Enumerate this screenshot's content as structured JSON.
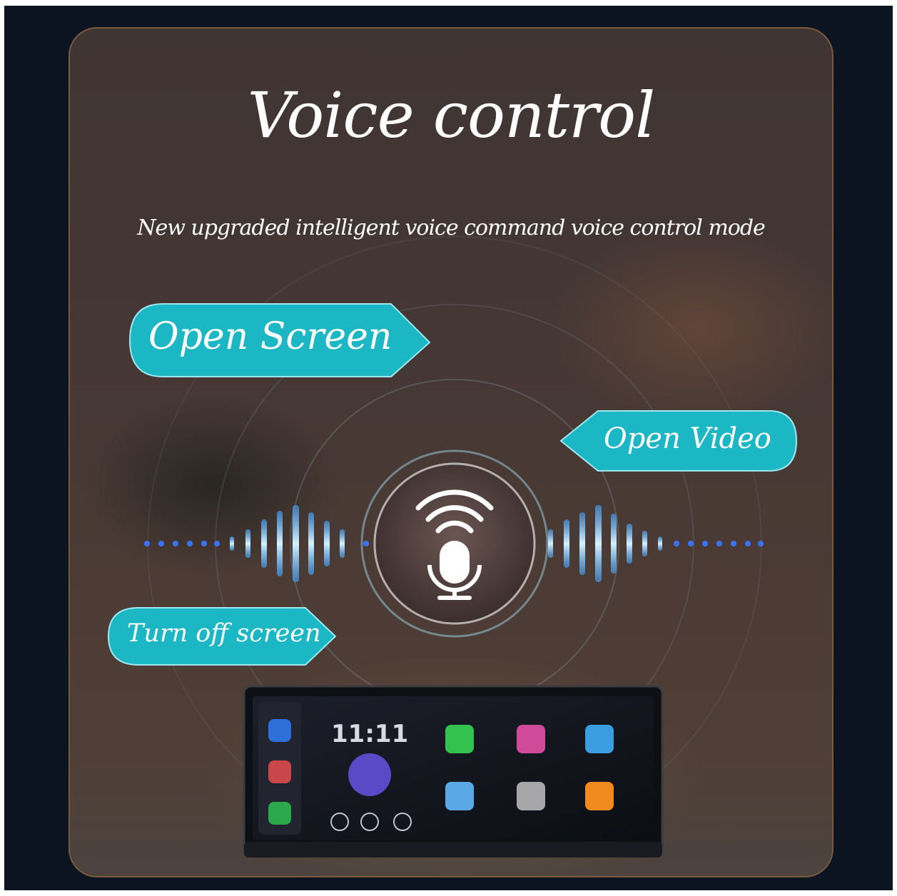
{
  "title": "Voice control",
  "subtitle": "New upgraded intelligent voice command voice control mode",
  "commands": {
    "open_screen": "Open Screen",
    "open_video": "Open Video",
    "turn_off_screen": "Turn off screen"
  },
  "device": {
    "time": "11:11"
  },
  "icons": {
    "center": "microphone-voice-icon"
  },
  "colors": {
    "bubble": "#1bb7c4",
    "wave": "#8fd8ff",
    "dots": "#2d6bff",
    "ring": "#9bd3e6"
  }
}
